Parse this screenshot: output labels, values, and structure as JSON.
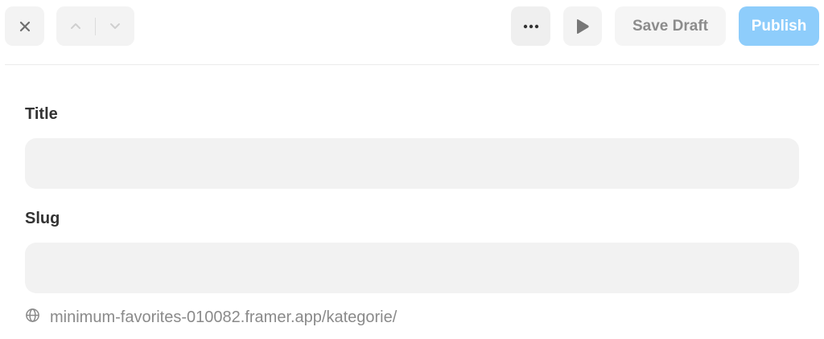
{
  "toolbar": {
    "close_icon": "close-icon",
    "nav_up_icon": "chevron-up-icon",
    "nav_down_icon": "chevron-down-icon",
    "more_icon": "more-horizontal-icon",
    "preview_icon": "play-icon",
    "save_draft_label": "Save Draft",
    "publish_label": "Publish"
  },
  "form": {
    "title": {
      "label": "Title",
      "value": "",
      "placeholder": ""
    },
    "slug": {
      "label": "Slug",
      "value": "",
      "placeholder": ""
    },
    "url_icon": "globe-icon",
    "url_preview": "minimum-favorites-010082.framer.app/kategorie/"
  },
  "colors": {
    "publish_bg": "#8ecdfb",
    "button_bg": "#f3f3f3",
    "input_bg": "#f2f2f2",
    "muted_text": "#8a8a8a"
  }
}
